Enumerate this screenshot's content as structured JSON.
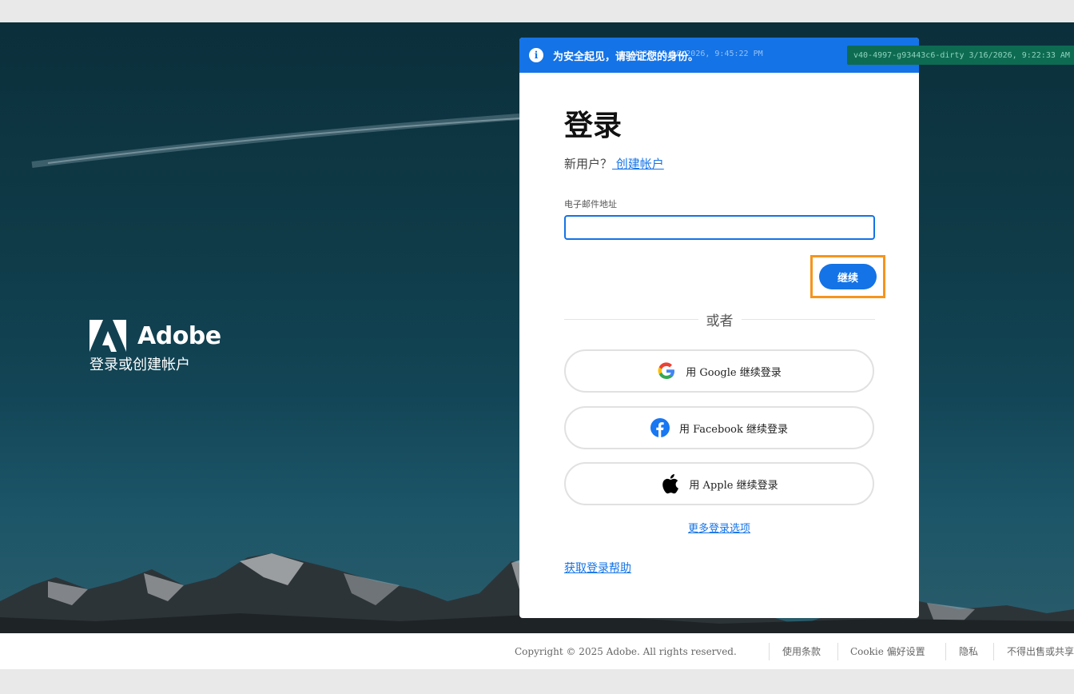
{
  "brand": {
    "name": "Adobe",
    "subtitle": "登录或创建帐户"
  },
  "banner": {
    "message": "为安全起见，请验证您的身份。",
    "debug_overlay": "gcad8875 3/16/2026, 9:45:22 PM"
  },
  "version_badge": "v40-4997-g93443c6-dirty 3/16/2026, 9:22:33 AM",
  "login": {
    "title": "登录",
    "new_user_prompt": "新用户？",
    "create_account_link": " 创建帐户",
    "email_label": "电子邮件地址",
    "email_value": "",
    "continue_label": "继续",
    "or_label": "或者",
    "google_label": "用 Google 继续登录",
    "facebook_label": "用 Facebook 继续登录",
    "apple_label": "用 Apple 继续登录",
    "more_options": "更多登录选项",
    "help": "获取登录帮助"
  },
  "footer": {
    "copyright": "Copyright © 2025 Adobe. All rights reserved.",
    "terms": "使用条款",
    "cookie": "Cookie 偏好设置",
    "privacy": "隐私",
    "donotsell": "不得出售或共享我的个人信息"
  },
  "colors": {
    "accent": "#1473e6",
    "highlight": "#f7941d",
    "badge": "#0d6b52"
  },
  "icons": [
    "info-icon",
    "google-icon",
    "facebook-icon",
    "apple-icon",
    "adobe-logo-icon"
  ]
}
